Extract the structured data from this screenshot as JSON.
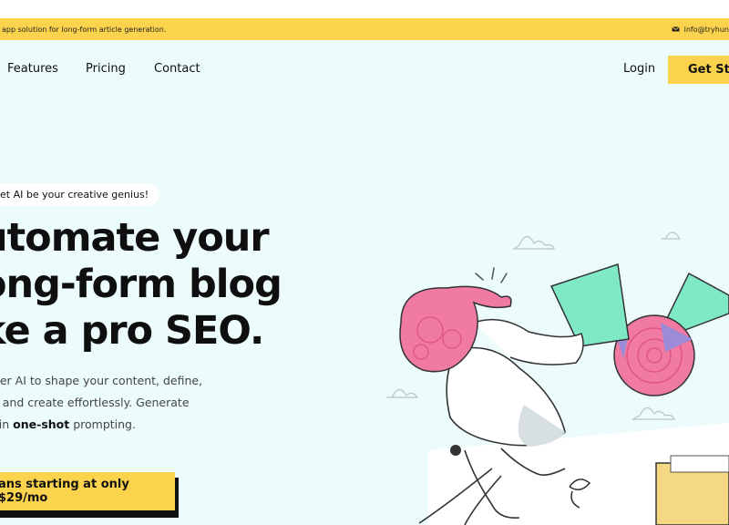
{
  "topbar": {
    "message": "app solution for long-form article generation.",
    "email": "info@tryhun"
  },
  "nav": {
    "links": [
      "Features",
      "Pricing",
      "Contact"
    ],
    "login": "Login",
    "cta": "Get Sta"
  },
  "hero": {
    "pill": "et AI be your creative genius!",
    "headline": [
      "utomate your",
      "ong-form blog",
      "ke a pro SEO."
    ],
    "description": {
      "line1": "ower AI to shape your content, define,",
      "line2": "er, and create effortlessly. Generate",
      "line3_prefix": "nt in ",
      "line3_bold": "one-shot",
      "line3_suffix": " prompting."
    },
    "cta": "ans starting at only $29/mo"
  },
  "colors": {
    "accent": "#fcd34d",
    "hero_bg": "#ecfbfc",
    "pink": "#f07aa2",
    "mint": "#7fe8c4",
    "purple": "#9b8bd8",
    "folder": "#f5d982"
  },
  "icons": [
    "mail-icon"
  ]
}
